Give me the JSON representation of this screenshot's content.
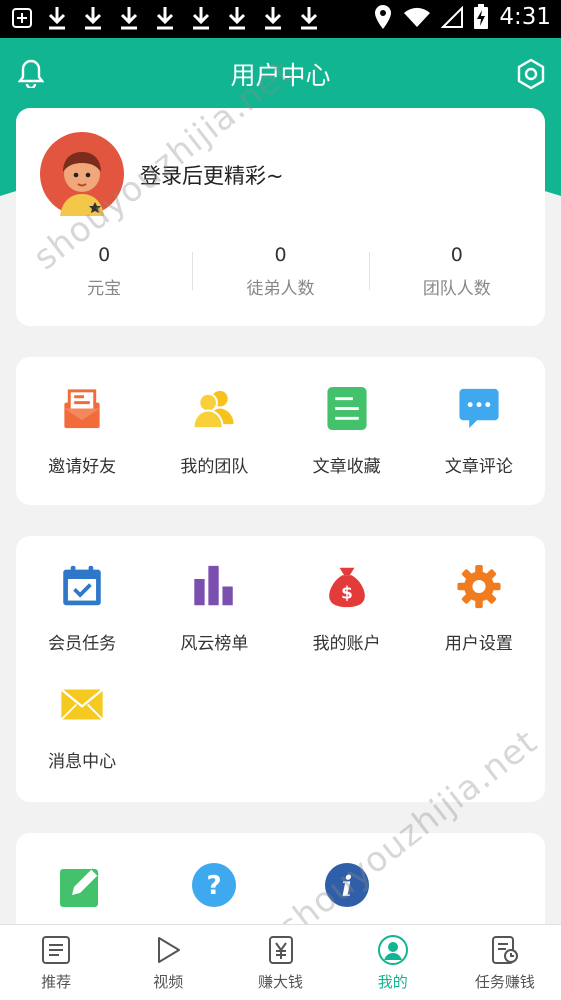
{
  "status_bar": {
    "time": "4:31",
    "icons": [
      "add-box-icon",
      "download-icon",
      "download-icon",
      "download-icon",
      "download-icon",
      "download-icon",
      "download-icon",
      "download-icon",
      "download-icon",
      "location-icon",
      "wifi-icon",
      "signal-icon",
      "battery-charging-icon"
    ]
  },
  "header": {
    "title": "用户中心",
    "left_icon": "bell-icon",
    "right_icon": "settings-icon",
    "accent_color": "#12b591"
  },
  "profile": {
    "login_prompt": "登录后更精彩~",
    "stats": [
      {
        "value": "0",
        "label": "元宝"
      },
      {
        "value": "0",
        "label": "徒弟人数"
      },
      {
        "value": "0",
        "label": "团队人数"
      }
    ]
  },
  "quick_actions": [
    {
      "label": "邀请好友",
      "icon": "invite-envelope-icon",
      "color": "#f26b3a"
    },
    {
      "label": "我的团队",
      "icon": "team-icon",
      "color": "#f7c21b"
    },
    {
      "label": "文章收藏",
      "icon": "document-icon",
      "color": "#43c16b"
    },
    {
      "label": "文章评论",
      "icon": "comment-icon",
      "color": "#3fa9f0"
    }
  ],
  "services": [
    {
      "label": "会员任务",
      "icon": "calendar-check-icon",
      "color": "#2f77c8"
    },
    {
      "label": "风云榜单",
      "icon": "bar-chart-icon",
      "color": "#7b4fb0"
    },
    {
      "label": "我的账户",
      "icon": "money-bag-icon",
      "color": "#e33a3a"
    },
    {
      "label": "用户设置",
      "icon": "gear-icon",
      "color": "#f07c1f"
    },
    {
      "label": "消息中心",
      "icon": "mail-icon",
      "color": "#f5c91f"
    }
  ],
  "more": [
    {
      "icon": "edit-icon",
      "color": "#43c16b"
    },
    {
      "icon": "help-icon",
      "color": "#3fa9f0"
    },
    {
      "icon": "info-icon",
      "color": "#2f5fa8"
    }
  ],
  "watermark": "shouyouzhijia.net",
  "bottom_nav": [
    {
      "label": "推荐",
      "icon": "list-icon",
      "active": false
    },
    {
      "label": "视频",
      "icon": "play-icon",
      "active": false
    },
    {
      "label": "赚大钱",
      "icon": "yen-icon",
      "active": false
    },
    {
      "label": "我的",
      "icon": "profile-icon",
      "active": true
    },
    {
      "label": "任务赚钱",
      "icon": "task-clock-icon",
      "active": false
    }
  ]
}
